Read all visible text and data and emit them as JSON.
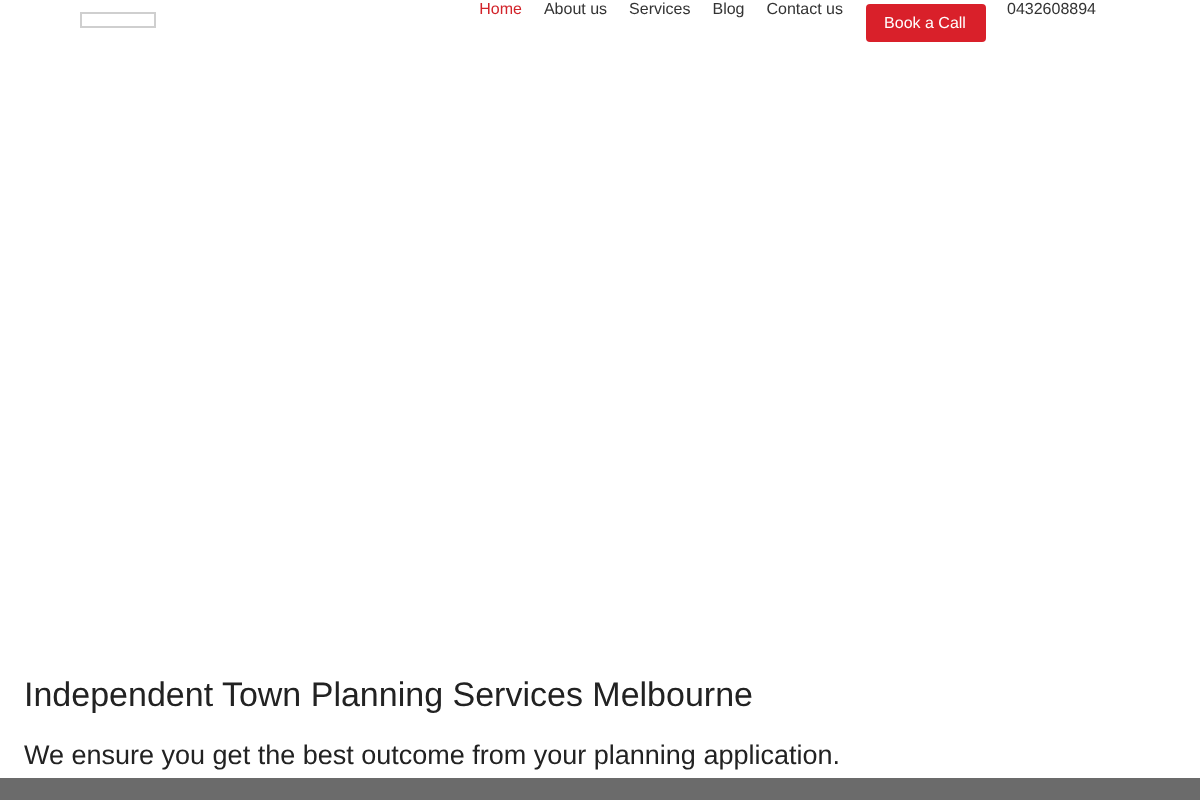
{
  "nav": {
    "items": [
      {
        "label": "Home",
        "selected": true
      },
      {
        "label": "About us",
        "selected": false
      },
      {
        "label": "Services",
        "selected": false
      },
      {
        "label": "Blog",
        "selected": false
      },
      {
        "label": "Contact us",
        "selected": false
      }
    ],
    "cta": "Book a Call",
    "phone": "0432608894"
  },
  "hero": {
    "title": "Independent Town Planning Services Melbourne",
    "subtitle": "We ensure you get the best outcome from your planning application."
  }
}
